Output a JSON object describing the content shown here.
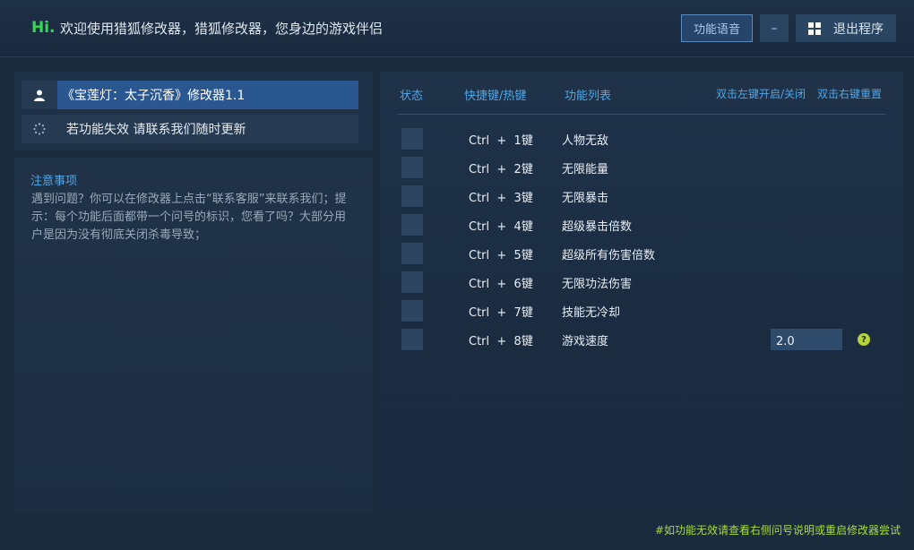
{
  "header": {
    "hi": "Hi.",
    "welcome": "欢迎使用猎狐修改器，猎狐修改器，您身边的游戏伴侣",
    "voice_label": "功能语音",
    "minimize_label": "–",
    "exit_label": "退出程序"
  },
  "left": {
    "game_title": "《宝莲灯：太子沉香》修改器1.1",
    "note_text": "若功能失效  请联系我们随时更新",
    "notice_title": "注意事项",
    "notice_text": "遇到问题？你可以在修改器上点击“联系客服”来联系我们；提示：每个功能后面都带一个问号的标识，您看了吗？大部分用户是因为没有彻底关闭杀毒导致；"
  },
  "table": {
    "col_status": "状态",
    "col_hotkey": "快捷键/热键",
    "col_features": "功能列表",
    "hint_left": "双击左键开启/关闭",
    "hint_right": "双击右键重置"
  },
  "cheats": [
    {
      "hotkey": "Ctrl  +  1键",
      "name": "人物无敌"
    },
    {
      "hotkey": "Ctrl  +  2键",
      "name": "无限能量"
    },
    {
      "hotkey": "Ctrl  +  3键",
      "name": "无限暴击"
    },
    {
      "hotkey": "Ctrl  +  4键",
      "name": "超级暴击倍数"
    },
    {
      "hotkey": "Ctrl  +  5键",
      "name": "超级所有伤害倍数"
    },
    {
      "hotkey": "Ctrl  +  6键",
      "name": "无限功法伤害"
    },
    {
      "hotkey": "Ctrl  +  7键",
      "name": "技能无冷却"
    },
    {
      "hotkey": "Ctrl  +  8键",
      "name": "游戏速度"
    }
  ],
  "speed_value": "2.0",
  "help_symbol": "?",
  "footer": "#如功能无效请查看右侧问号说明或重启修改器尝试",
  "colors": {
    "accent_green": "#2edc4d",
    "accent_blue": "#4fa6e6",
    "selected_row": "#2b5790",
    "footer_note": "#a7dc3a"
  }
}
